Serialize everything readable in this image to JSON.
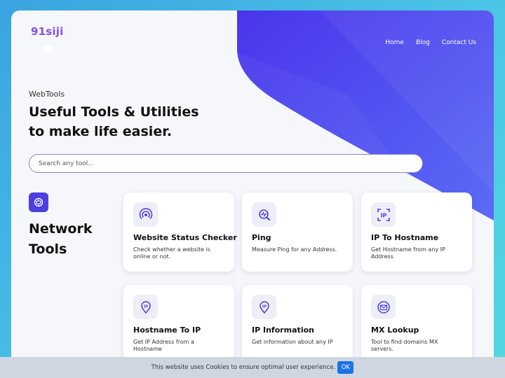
{
  "brand": {
    "logo": "91siji"
  },
  "nav": {
    "items": [
      "Home",
      "Blog",
      "Contact Us"
    ]
  },
  "hero": {
    "eyebrow": "WebTools",
    "line1": "Useful Tools & Utilities",
    "line2": "to make life easier."
  },
  "search": {
    "placeholder": "Search any tool..."
  },
  "section": {
    "title_line1": "Network",
    "title_line2": "Tools",
    "icon": "network-icon"
  },
  "tools": [
    {
      "title": "Website Status Checker",
      "desc": "Check whether a website is online or not.",
      "icon": "signal-icon"
    },
    {
      "title": "Ping",
      "desc": "Measure Ping for any Address.",
      "icon": "pulse-search-icon"
    },
    {
      "title": "IP To Hostname",
      "desc": "Get Hostname from any IP Address",
      "icon": "ip-scan-icon"
    },
    {
      "title": "Hostname To IP",
      "desc": "Get IP Address from a Hostname",
      "icon": "ip-pin-icon"
    },
    {
      "title": "IP Information",
      "desc": "Get information about any IP",
      "icon": "ip-pin-icon"
    },
    {
      "title": "MX Lookup",
      "desc": "Tool to find domains MX servers.",
      "icon": "mail-search-icon"
    }
  ],
  "cookie": {
    "text": "This website uses Cookies to ensure optimal user experience.",
    "button": "OK"
  },
  "colors": {
    "accent": "#4d3fe0",
    "hero_blue": "#4a3ff0",
    "logo": "#8a4fe6",
    "cookie_button": "#1a73e8"
  }
}
